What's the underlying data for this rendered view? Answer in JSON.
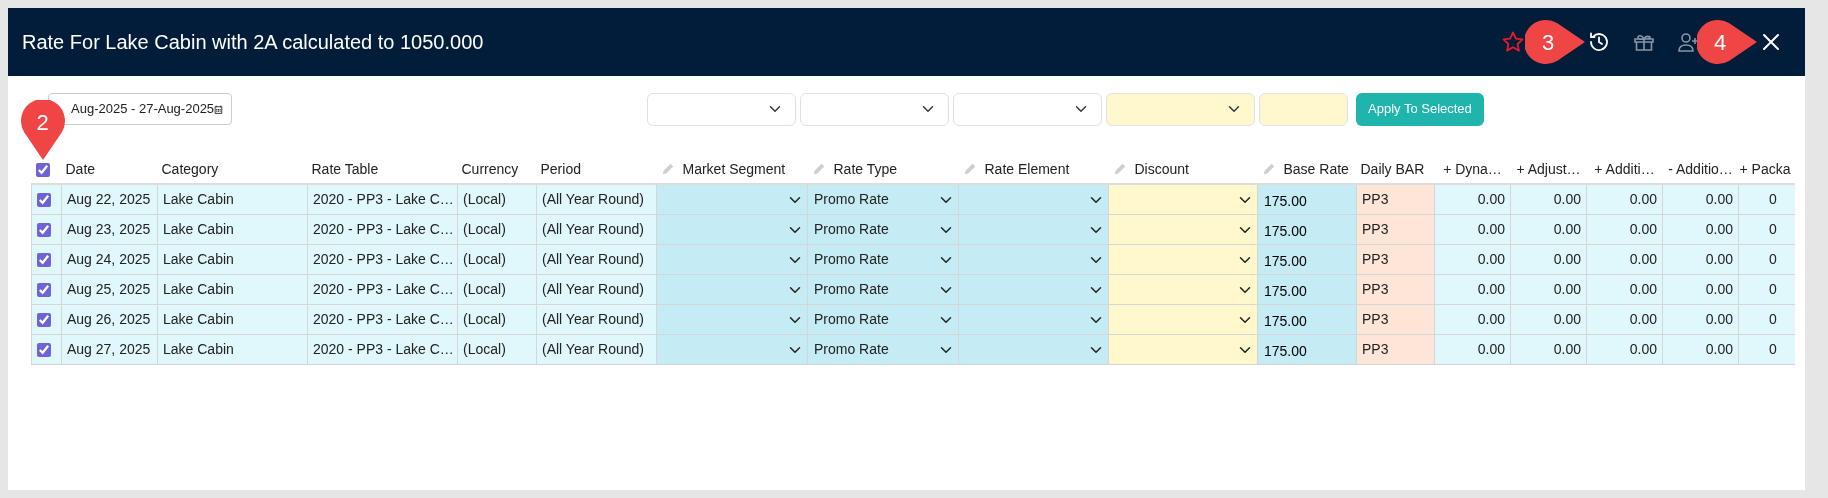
{
  "modal": {
    "title": "Rate For Lake Cabin with 2A calculated to 1050.000",
    "header_icons": [
      {
        "kind": "star"
      },
      {
        "kind": "history",
        "callout": "3"
      },
      {
        "kind": "gift"
      },
      {
        "kind": "user_add"
      },
      {
        "kind": "close",
        "callout": "4"
      }
    ]
  },
  "date_range": {
    "value": "Aug-2025 - 27-Aug-2025"
  },
  "filters": [
    {
      "kind": "select",
      "highlighted": false
    },
    {
      "kind": "select",
      "highlighted": false
    },
    {
      "kind": "select",
      "highlighted": false
    },
    {
      "kind": "select",
      "highlighted": true
    },
    {
      "kind": "input",
      "highlighted": true
    }
  ],
  "apply_button": "Apply To Selected",
  "table": {
    "select_all": true,
    "select_all_callout": "2",
    "columns": [
      {
        "label": "Date",
        "kind": "text",
        "editable": false,
        "color": "#e0f7fc"
      },
      {
        "label": "Category",
        "kind": "text",
        "editable": false,
        "color": "#e0f7fc"
      },
      {
        "label": "Rate Table",
        "kind": "text",
        "editable": false,
        "color": "#e0f7fc"
      },
      {
        "label": "Currency",
        "kind": "text",
        "editable": false,
        "color": "#e0f7fc"
      },
      {
        "label": "Period",
        "kind": "text",
        "editable": false,
        "color": "#e0f7fc"
      },
      {
        "label": "Market Segment",
        "kind": "select",
        "editable": true,
        "color": "#c5ebf4"
      },
      {
        "label": "Rate Type",
        "kind": "select",
        "editable": true,
        "color": "#c5ebf4"
      },
      {
        "label": "Rate Element",
        "kind": "select",
        "editable": true,
        "color": "#c5ebf4"
      },
      {
        "label": "Discount",
        "kind": "select",
        "editable": true,
        "color": "#fff8cc"
      },
      {
        "label": "Base Rate",
        "kind": "input",
        "editable": true,
        "color": "#c5ebf4"
      },
      {
        "label": "Daily BAR",
        "kind": "text",
        "editable": false,
        "color": "#fde6d8"
      },
      {
        "label": "+ Dyna…",
        "kind": "number",
        "editable": false,
        "color": "#e0f7fc"
      },
      {
        "label": "+ Adjust…",
        "kind": "number",
        "editable": false,
        "color": "#e0f7fc"
      },
      {
        "label": "+ Additi…",
        "kind": "number",
        "editable": false,
        "color": "#e0f7fc"
      },
      {
        "label": "- Additio…",
        "kind": "number",
        "editable": false,
        "color": "#e0f7fc"
      },
      {
        "label": "+ Packa",
        "kind": "cut",
        "editable": false,
        "color": "#e0f7fc"
      }
    ],
    "rows": [
      {
        "selected": true,
        "cells": [
          "Aug 22, 2025",
          "Lake Cabin",
          "2020 - PP3 - Lake C…",
          "(Local)",
          "(All Year Round)",
          "",
          "Promo Rate",
          "",
          "",
          "175.00",
          "PP3",
          "0.00",
          "0.00",
          "0.00",
          "0.00",
          "0"
        ]
      },
      {
        "selected": true,
        "cells": [
          "Aug 23, 2025",
          "Lake Cabin",
          "2020 - PP3 - Lake C…",
          "(Local)",
          "(All Year Round)",
          "",
          "Promo Rate",
          "",
          "",
          "175.00",
          "PP3",
          "0.00",
          "0.00",
          "0.00",
          "0.00",
          "0"
        ]
      },
      {
        "selected": true,
        "cells": [
          "Aug 24, 2025",
          "Lake Cabin",
          "2020 - PP3 - Lake C…",
          "(Local)",
          "(All Year Round)",
          "",
          "Promo Rate",
          "",
          "",
          "175.00",
          "PP3",
          "0.00",
          "0.00",
          "0.00",
          "0.00",
          "0"
        ]
      },
      {
        "selected": true,
        "cells": [
          "Aug 25, 2025",
          "Lake Cabin",
          "2020 - PP3 - Lake C…",
          "(Local)",
          "(All Year Round)",
          "",
          "Promo Rate",
          "",
          "",
          "175.00",
          "PP3",
          "0.00",
          "0.00",
          "0.00",
          "0.00",
          "0"
        ]
      },
      {
        "selected": true,
        "cells": [
          "Aug 26, 2025",
          "Lake Cabin",
          "2020 - PP3 - Lake C…",
          "(Local)",
          "(All Year Round)",
          "",
          "Promo Rate",
          "",
          "",
          "175.00",
          "PP3",
          "0.00",
          "0.00",
          "0.00",
          "0.00",
          "0"
        ]
      },
      {
        "selected": true,
        "cells": [
          "Aug 27, 2025",
          "Lake Cabin",
          "2020 - PP3 - Lake C…",
          "(Local)",
          "(All Year Round)",
          "",
          "Promo Rate",
          "",
          "",
          "175.00",
          "PP3",
          "0.00",
          "0.00",
          "0.00",
          "0.00",
          "0"
        ]
      }
    ]
  }
}
